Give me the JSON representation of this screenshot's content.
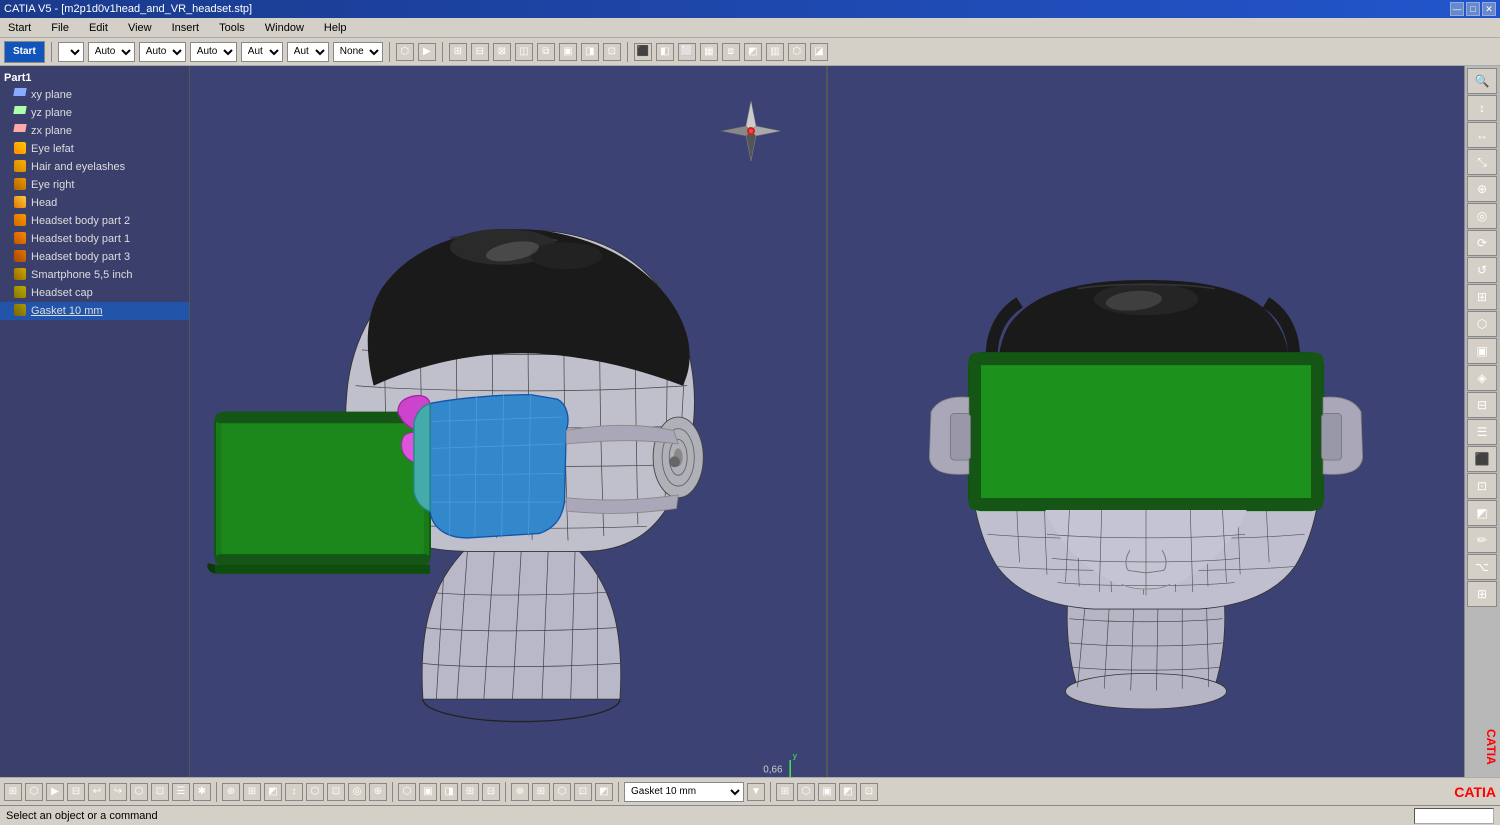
{
  "titleBar": {
    "title": "CATIA V5 - [m2p1d0v1head_and_VR_headset.stp]",
    "buttons": [
      "—",
      "□",
      "✕"
    ]
  },
  "menuBar": {
    "items": [
      "Start",
      "File",
      "Edit",
      "View",
      "Insert",
      "Tools",
      "Window",
      "Help"
    ]
  },
  "toolbar": {
    "selects": [
      {
        "value": "",
        "label": ""
      },
      {
        "value": "Auto",
        "label": "Auto"
      },
      {
        "value": "Auto",
        "label": "Auto"
      },
      {
        "value": "Auto",
        "label": "Auto"
      },
      {
        "value": "Aut",
        "label": "Aut"
      },
      {
        "value": "Aut",
        "label": "Aut"
      },
      {
        "value": "None",
        "label": "None"
      }
    ]
  },
  "treePanel": {
    "root": "Part1",
    "items": [
      {
        "label": "xy plane",
        "type": "plane",
        "depth": 1
      },
      {
        "label": "yz plane",
        "type": "plane",
        "depth": 1
      },
      {
        "label": "zx plane",
        "type": "plane",
        "depth": 1
      },
      {
        "label": "Eye lefat",
        "type": "mesh",
        "depth": 1
      },
      {
        "label": "Hair and eyelashes",
        "type": "mesh",
        "depth": 1
      },
      {
        "label": "Eye right",
        "type": "mesh",
        "depth": 1
      },
      {
        "label": "Head",
        "type": "mesh",
        "depth": 1
      },
      {
        "label": "Headset body part 2",
        "type": "mesh",
        "depth": 1
      },
      {
        "label": "Headset body part 1",
        "type": "mesh",
        "depth": 1
      },
      {
        "label": "Headset body part 3",
        "type": "mesh",
        "depth": 1
      },
      {
        "label": "Smartphone 5,5 inch",
        "type": "mesh",
        "depth": 1
      },
      {
        "label": "Headset cap",
        "type": "mesh",
        "depth": 1
      },
      {
        "label": "Gasket 10 mm",
        "type": "mesh",
        "depth": 1,
        "selected": true,
        "underline": true
      }
    ]
  },
  "statusBar": {
    "text": "Select an object or a command"
  },
  "bottomToolbar": {
    "gasketLabel": "Gasket 10 mm"
  },
  "scale": "0,66",
  "catia": "CATIA"
}
